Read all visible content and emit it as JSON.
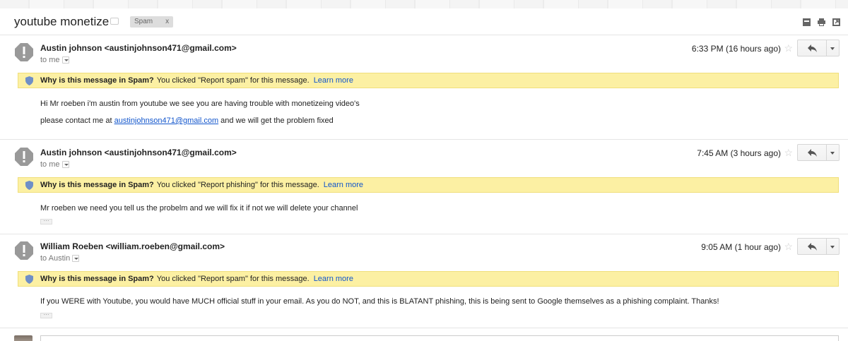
{
  "thread": {
    "subject": "youtube monetize",
    "label_chip": "Spam",
    "label_close": "x",
    "header_icons": [
      "archive-icon",
      "print-icon",
      "new-window-icon"
    ]
  },
  "messages": [
    {
      "sender_name": "Austin johnson",
      "sender_addr": "<austinjohnson471@gmail.com>",
      "to": "to me",
      "time": "6:33 PM (16 hours ago)",
      "banner_q": "Why is this message in Spam?",
      "banner_text": "You clicked \"Report spam\" for this message.",
      "banner_link": "Learn more",
      "body_1": "Hi Mr roeben i'm austin from youtube we see you are having trouble with monetizeing video's",
      "body_2_pre": "please contact me at",
      "body_2_link": "austinjohnson471@gmail.com",
      "body_2_post": "and we will get the problem fixed"
    },
    {
      "sender_name": "Austin johnson",
      "sender_addr": "<austinjohnson471@gmail.com>",
      "to": "to me",
      "time": "7:45 AM (3 hours ago)",
      "banner_q": "Why is this message in Spam?",
      "banner_text": "You clicked \"Report phishing\" for this message.",
      "banner_link": "Learn more",
      "body_1": "Mr roeben we need you tell us the probelm and we will fix it if not we will delete your channel",
      "ellipsis": "···"
    },
    {
      "sender_name": "William Roeben",
      "sender_addr": "<william.roeben@gmail.com>",
      "to": "to Austin",
      "time": "9:05 AM (1 hour ago)",
      "banner_q": "Why is this message in Spam?",
      "banner_text": "You clicked \"Report spam\" for this message.",
      "banner_link": "Learn more",
      "body_1": "If you WERE with Youtube, you would have MUCH official stuff in your email. As you do NOT, and this is BLATANT phishing, this is being sent to Google themselves as a phishing complaint. Thanks!",
      "ellipsis": "···"
    }
  ],
  "colors": {
    "banner_bg": "#fcf0a3",
    "link": "#1155cc",
    "warning_icon": "#999999"
  }
}
